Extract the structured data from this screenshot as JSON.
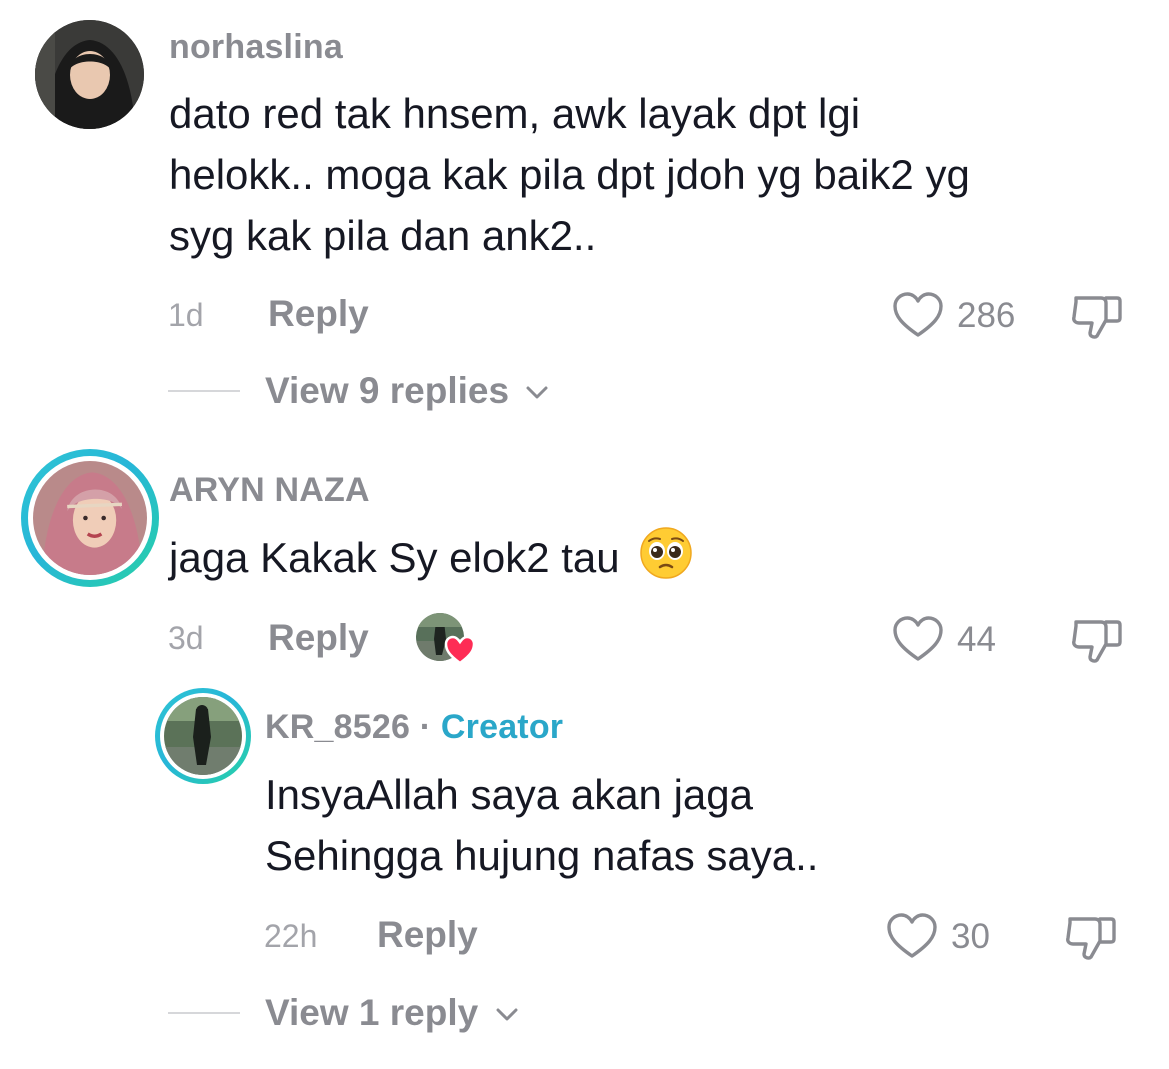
{
  "comments": [
    {
      "username": "norhaslina",
      "lines": [
        "dato red tak hnsem, awk layak dpt lgi",
        "helokk.. moga kak pila dpt jdoh yg baik2 yg",
        "syg kak pila dan ank2.."
      ],
      "time": "1d",
      "reply_label": "Reply",
      "likes": "286",
      "view_replies": "View 9 replies"
    },
    {
      "username": "ARYN NAZA",
      "text": "jaga Kakak Sy elok2 tau",
      "emoji": "pleading-face",
      "time": "3d",
      "reply_label": "Reply",
      "likes": "44",
      "creator_liked": true,
      "reply": {
        "username": "KR_8526",
        "separator": "·",
        "badge": "Creator",
        "lines": [
          "InsyaAllah saya akan jaga",
          "Sehingga hujung nafas saya.."
        ],
        "time": "22h",
        "reply_label": "Reply",
        "likes": "30"
      },
      "view_replies": "View 1 reply"
    }
  ],
  "colors": {
    "username": "#8a8b91",
    "text": "#161823",
    "creator_badge": "#2aa7c9",
    "ring_gradient_start": "#2ec5d3",
    "ring_gradient_end": "#27d1a6",
    "like_heart_red": "#fe2c55"
  }
}
